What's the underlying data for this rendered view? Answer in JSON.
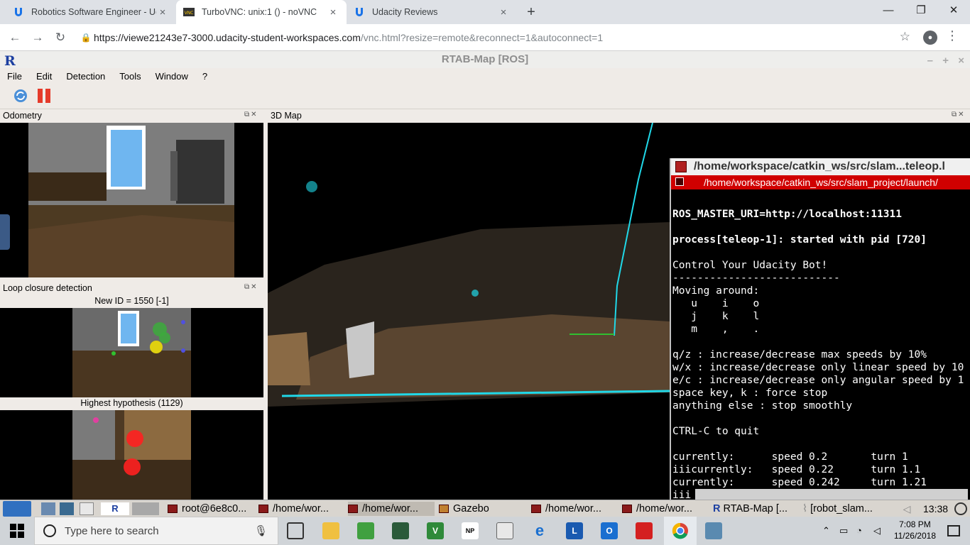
{
  "browser": {
    "tabs": [
      {
        "title": "Robotics Software Engineer - Uda",
        "icon": "udacity-icon"
      },
      {
        "title": "TurboVNC: unix:1 () - noVNC",
        "icon": "vnc-icon"
      },
      {
        "title": "Udacity Reviews",
        "icon": "udacity-icon"
      }
    ],
    "url_host": "https://viewe21243e7-3000.udacity-student-workspaces.com",
    "url_path": "/vnc.html?resize=remote&reconnect=1&autoconnect=1"
  },
  "app": {
    "title": "RTAB-Map [ROS]",
    "menu": [
      "File",
      "Edit",
      "Detection",
      "Tools",
      "Window",
      "?"
    ],
    "panels": {
      "odometry": "Odometry",
      "loop_closure": "Loop closure detection",
      "map3d": "3D Map",
      "new_id": "New ID = 1550 [-1]",
      "highest_hypothesis": "Highest hypothesis (1129)"
    }
  },
  "terminal": {
    "title": "/home/workspace/catkin_ws/src/slam...teleop.l",
    "tab": "/home/workspace/catkin_ws/src/slam_project/launch/",
    "lines": [
      "ROS_MASTER_URI=http://localhost:11311",
      "",
      "process[teleop-1]: started with pid [720]",
      "",
      "Control Your Udacity Bot!",
      "---------------------------",
      "Moving around:",
      "   u    i    o",
      "   j    k    l",
      "   m    ,    .",
      "",
      "q/z : increase/decrease max speeds by 10%",
      "w/x : increase/decrease only linear speed by 10",
      "e/c : increase/decrease only angular speed by 1",
      "space key, k : force stop",
      "anything else : stop smoothly",
      "",
      "CTRL-C to quit",
      "",
      "currently:      speed 0.2       turn 1",
      "iiicurrently:   speed 0.22      turn 1.1",
      "currently:      speed 0.242     turn 1.21",
      "iii"
    ]
  },
  "vnc_taskbar": {
    "items": [
      "root@6e8c0...",
      "/home/wor...",
      "/home/wor...",
      "Gazebo",
      "/home/wor...",
      "/home/wor...",
      "RTAB-Map [...",
      "[robot_slam..."
    ],
    "time": "13:38"
  },
  "windows_taskbar": {
    "search_placeholder": "Type here to search",
    "time": "7:08 PM",
    "date": "11/26/2018"
  }
}
